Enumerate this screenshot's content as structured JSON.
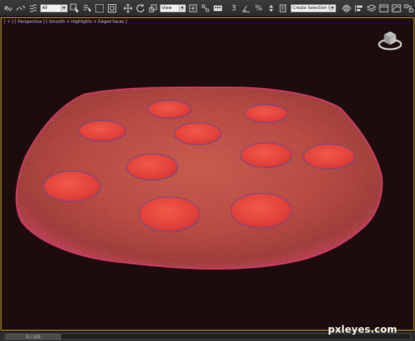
{
  "toolbar": {
    "filter_select": "All",
    "coord_select": "View",
    "selection_set": "Create Selection Se",
    "icons": [
      "link-icon",
      "unlink-icon",
      "bind-space-warp-icon",
      "select-object-icon",
      "select-by-name-icon",
      "rect-selection-icon",
      "window-crossing-icon",
      "move-icon",
      "rotate-icon",
      "scale-icon",
      "use-pivot-icon",
      "select-manipulate-icon",
      "keyboard-shortcut-icon",
      "snap-3d-icon",
      "angle-snap-icon",
      "percent-snap-icon",
      "spinner-snap-icon",
      "edit-named-selection-icon",
      "mirror-icon",
      "align-icon",
      "layer-manager-icon",
      "graphite-ribbon-icon",
      "curve-editor-icon",
      "schematic-view-icon"
    ],
    "snap_3_label": "3",
    "percent_label": "%"
  },
  "viewport": {
    "label": "[ + ] [ Perspective ] [ Smooth + Highlights + Edged Faces ]",
    "background_color": "#1c0c0b",
    "border_color": "#e6b11c",
    "dough_color": "#b5473f",
    "pepperoni_color": "#e8473a",
    "pepperoni_edge_color": "#5a4a9a",
    "pepperoni_count": 10
  },
  "timeline": {
    "frame_label": "0 / 100"
  },
  "watermark": "pxleyes.com"
}
